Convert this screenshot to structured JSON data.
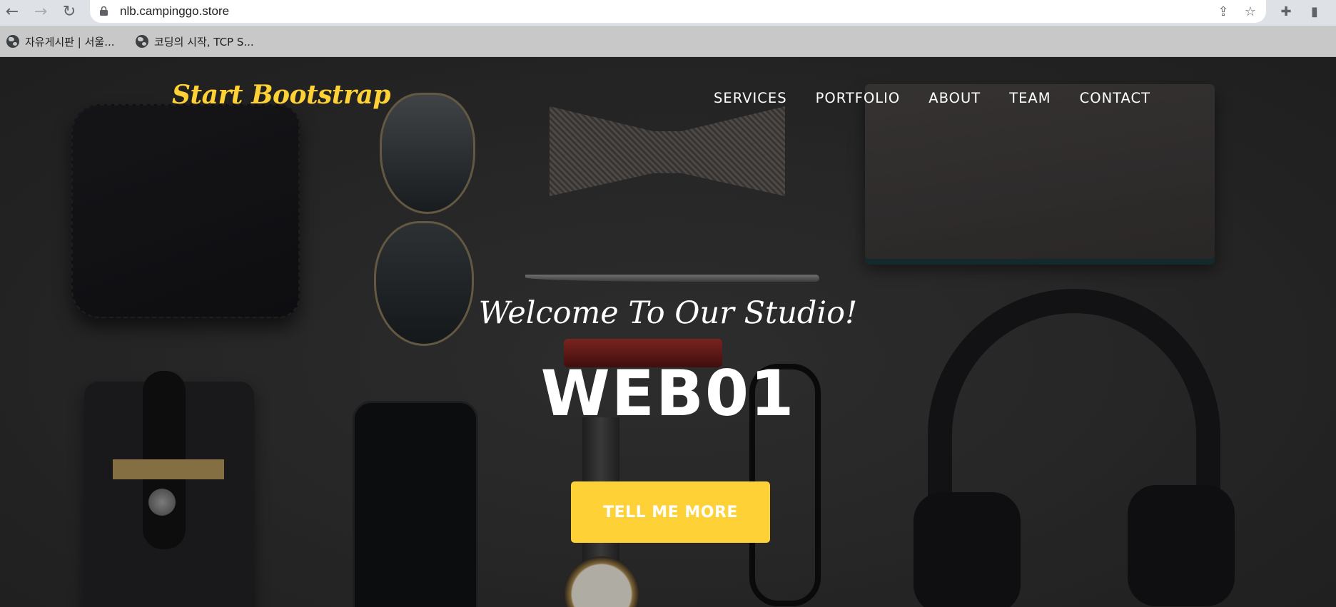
{
  "browser": {
    "url": "nlb.campinggo.store",
    "bookmarks": [
      {
        "label": "자유게시판 | 서울..."
      },
      {
        "label": "코딩의 시작, TCP S..."
      }
    ]
  },
  "page": {
    "brand": "Start Bootstrap",
    "nav": [
      "SERVICES",
      "PORTFOLIO",
      "ABOUT",
      "TEAM",
      "CONTACT"
    ],
    "hero": {
      "subheading": "Welcome To Our Studio!",
      "heading": "WEB01",
      "button": "TELL ME MORE"
    },
    "colors": {
      "accent": "#fed136",
      "text": "#ffffff"
    }
  }
}
